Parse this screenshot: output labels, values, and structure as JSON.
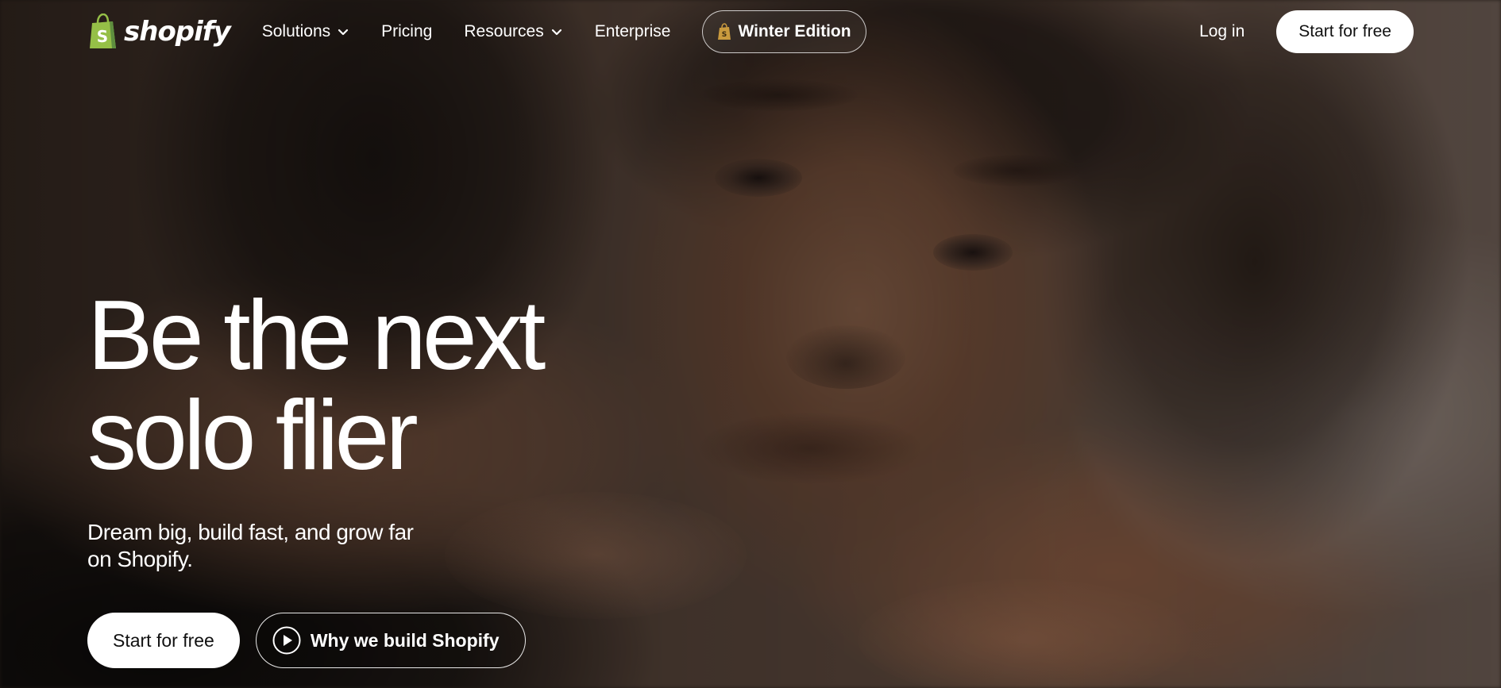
{
  "nav": {
    "logo_text": "shopify",
    "items": [
      {
        "label": "Solutions",
        "dropdown": true
      },
      {
        "label": "Pricing",
        "dropdown": false
      },
      {
        "label": "Resources",
        "dropdown": true
      },
      {
        "label": "Enterprise",
        "dropdown": false
      }
    ],
    "edition_label": "Winter Edition",
    "login_label": "Log in",
    "cta_label": "Start for free"
  },
  "hero": {
    "title_line1": "Be the next",
    "title_line2": "solo flier",
    "subtitle": "Dream big, build fast, and grow far on Shopify.",
    "primary_cta": "Start for free",
    "secondary_cta": "Why we build Shopify"
  },
  "colors": {
    "brand_green": "#95bf47",
    "brand_green_dark": "#5e8e3e",
    "button_bg": "#ffffff",
    "button_text": "#111111"
  },
  "icons": {
    "logo": "shopify-bag-icon",
    "edition": "shopify-bag-icon",
    "dropdown": "chevron-down-icon",
    "video": "play-icon"
  }
}
